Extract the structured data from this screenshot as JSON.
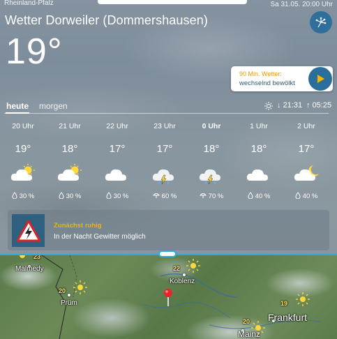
{
  "header": {
    "region": "Rheinland-Pfalz",
    "datetime": "Sa 31.05. 20:00 Uhr",
    "location": "Wetter Dorweiler (Dommershausen)",
    "temperature": "19°"
  },
  "nowcast": {
    "title": "90 Min. Wetter:",
    "text": "wechselnd bewölkt"
  },
  "tabs": {
    "today": "heute",
    "tomorrow": "morgen"
  },
  "sun": {
    "sunset": "21:31",
    "sunrise": "05:25"
  },
  "hours": [
    {
      "time": "20 Uhr",
      "temp": "19°",
      "icon": "sun-cloud-icon",
      "precip_icon": "raindrop-icon",
      "precip": "30 %"
    },
    {
      "time": "21 Uhr",
      "temp": "18°",
      "icon": "sun-cloud-icon",
      "precip_icon": "raindrop-icon",
      "precip": "30 %"
    },
    {
      "time": "22 Uhr",
      "temp": "17°",
      "icon": "cloud-icon",
      "precip_icon": "raindrop-icon",
      "precip": "30 %"
    },
    {
      "time": "23 Uhr",
      "temp": "17°",
      "icon": "thunderstorm-icon",
      "precip_icon": "umbrella-icon",
      "precip": "60 %"
    },
    {
      "time": "0 Uhr",
      "temp": "18°",
      "icon": "thunderstorm-icon",
      "precip_icon": "umbrella-icon",
      "precip": "70 %"
    },
    {
      "time": "1 Uhr",
      "temp": "18°",
      "icon": "cloud-icon",
      "precip_icon": "raindrop-icon",
      "precip": "40 %"
    },
    {
      "time": "2 Uhr",
      "temp": "17°",
      "icon": "moon-cloud-icon",
      "precip_icon": "raindrop-icon",
      "precip": "40 %"
    }
  ],
  "warning": {
    "title": "Zunächst ruhig",
    "text": "In der Nacht Gewitter möglich"
  },
  "map": {
    "cities": [
      "Malmedy",
      "Prüm",
      "Koblenz",
      "Frankfurt",
      "Mainz"
    ],
    "temps": [
      "23",
      "20",
      "22",
      "19",
      "20"
    ]
  },
  "colors": {
    "accent": "#2a6e9c",
    "nowcast_title": "#e89a00",
    "warning_title": "#f2b400",
    "map_divider": "#2fa8d8"
  }
}
